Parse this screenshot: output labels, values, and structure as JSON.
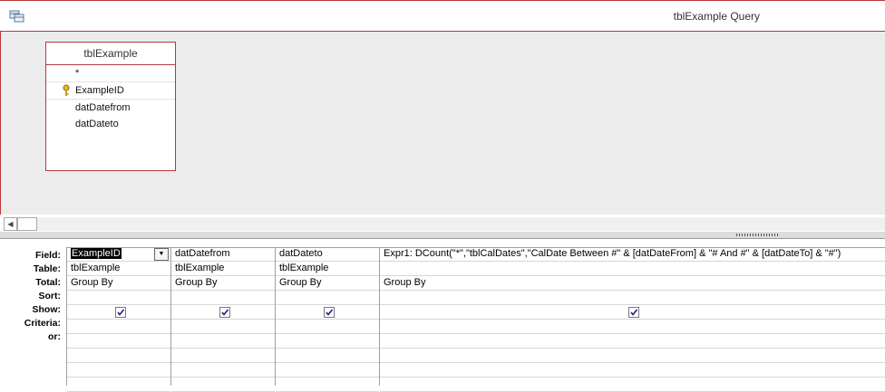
{
  "window": {
    "title": "tblExample Query",
    "icon": "query-design-icon"
  },
  "table_box": {
    "title": "tblExample",
    "fields": [
      "*",
      "ExampleID",
      "datDatefrom",
      "datDateto"
    ],
    "primary_key_field_index": 1
  },
  "grid": {
    "row_labels": [
      "Field:",
      "Table:",
      "Total:",
      "Sort:",
      "Show:",
      "Criteria:",
      "or:"
    ],
    "columns": [
      {
        "field": "ExampleID",
        "table": "tblExample",
        "total": "Group By",
        "sort": "",
        "show": true
      },
      {
        "field": "datDatefrom",
        "table": "tblExample",
        "total": "Group By",
        "sort": "",
        "show": true
      },
      {
        "field": "datDateto",
        "table": "tblExample",
        "total": "Group By",
        "sort": "",
        "show": true
      },
      {
        "field": "Expr1: DCount(\"*\",\"tblCalDates\",\"CalDate Between #\" & [datDateFrom] & \"# And #\" & [datDateTo] & \"#\")",
        "table": "",
        "total": "Group By",
        "sort": "",
        "show": true
      }
    ]
  },
  "colors": {
    "accent": "#b5393b",
    "pane_bg": "#ececec"
  }
}
